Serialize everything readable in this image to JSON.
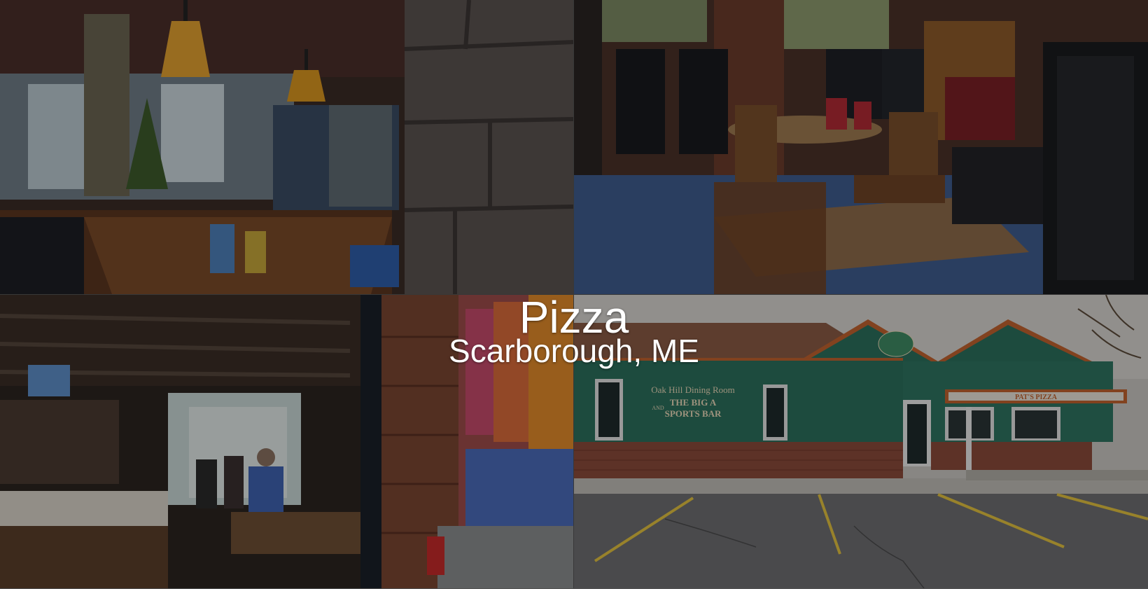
{
  "hero": {
    "title": "Pizza",
    "subtitle": "Scarborough, ME"
  },
  "photos": [
    {
      "name": "restaurant-bar-interior-photo"
    },
    {
      "name": "dining-room-tables-photo"
    },
    {
      "name": "industrial-bar-interior-photo"
    },
    {
      "name": "restaurant-exterior-photo"
    }
  ],
  "building_signs": {
    "dining_room": "Oak Hill Dining Room",
    "and": "AND",
    "big_a_line1": "THE BIG A",
    "big_a_line2": "SPORTS BAR",
    "pizza_banner": "PAT'S PIZZA"
  },
  "colors": {
    "text": "#ffffff",
    "overlay": "rgba(0,0,0,0.32)",
    "building_green": "#2c6f5c",
    "trim_orange": "#c0622e"
  }
}
